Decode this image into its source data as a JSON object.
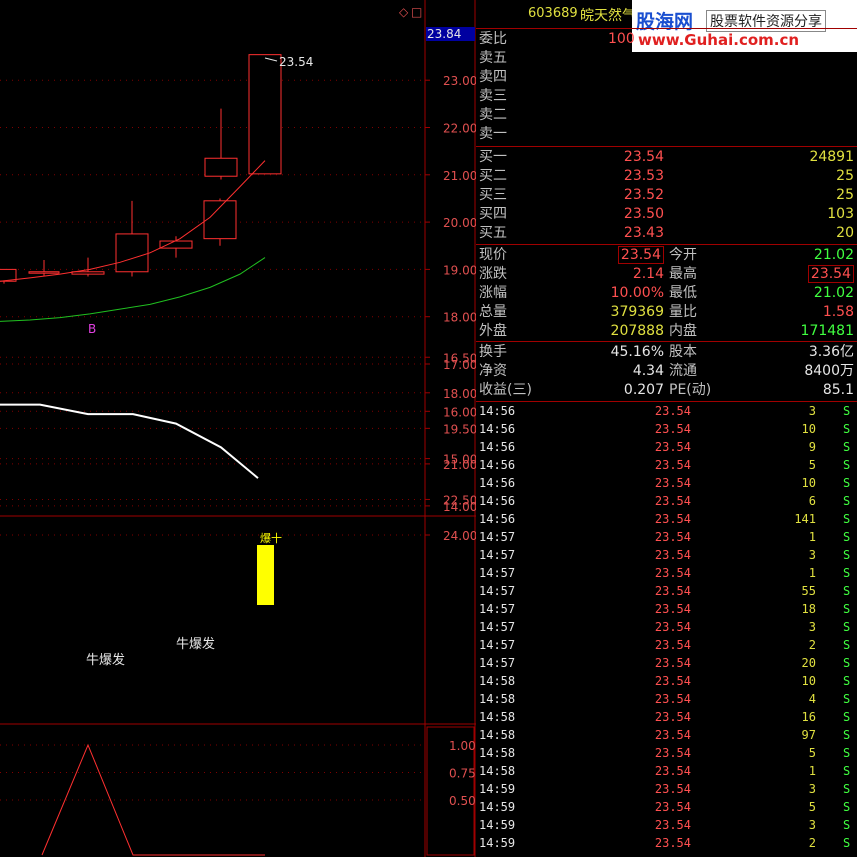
{
  "header": {
    "code": "603689",
    "name": "皖天然气"
  },
  "watermark": {
    "site_cn": "股海网",
    "slogan": "股票软件资源分享",
    "url": "www.Guhai.com.cn"
  },
  "window_icons": {
    "restore": "◇",
    "maximize": "□"
  },
  "price_chart": {
    "current_price_tag": "23.84",
    "high_label": "23.54",
    "marker_label": "B",
    "y_ticks": [
      "23.00",
      "22.00",
      "21.00",
      "20.00",
      "19.00",
      "18.00",
      "17.00",
      "16.00",
      "15.00",
      "14.00"
    ],
    "candles": [
      {
        "open": 19.0,
        "close": 18.75,
        "high": 19.0,
        "low": 18.7
      },
      {
        "open": 18.95,
        "close": 18.92,
        "high": 19.2,
        "low": 18.85
      },
      {
        "open": 18.9,
        "close": 18.95,
        "high": 19.25,
        "low": 18.85
      },
      {
        "open": 18.95,
        "close": 19.75,
        "high": 20.45,
        "low": 18.85
      },
      {
        "open": 19.45,
        "close": 19.6,
        "high": 19.7,
        "low": 19.25
      },
      {
        "open": 19.65,
        "close": 20.45,
        "high": 20.5,
        "low": 19.5
      },
      {
        "open": 20.97,
        "close": 21.35,
        "high": 22.4,
        "low": 20.9
      },
      {
        "open": 21.02,
        "close": 23.54,
        "high": 23.54,
        "low": 21.02
      }
    ],
    "ma_red": [
      18.75,
      18.82,
      18.9,
      19.0,
      19.15,
      19.35,
      19.65,
      20.1,
      20.75,
      21.3
    ],
    "ma_green": [
      17.9,
      17.93,
      17.98,
      18.06,
      18.16,
      18.26,
      18.42,
      18.62,
      18.9,
      19.25
    ]
  },
  "indicator_chart": {
    "labels": [
      "牛爆发",
      "牛爆发"
    ],
    "bar_label": "爆十",
    "y_ticks": [
      "24.00",
      "22.50",
      "21.00",
      "19.50",
      "18.00",
      "16.50"
    ],
    "line": [
      18.5,
      18.5,
      18.6,
      18.9,
      19.3,
      19.3,
      19.8,
      20.5,
      21.5,
      22.3
    ]
  },
  "lower_chart": {
    "y_ticks": [
      "1.00",
      "0.75",
      "0.50"
    ],
    "line": [
      0,
      0,
      0,
      1,
      0,
      0,
      0,
      0,
      0,
      0,
      0,
      0
    ]
  },
  "quote": {
    "weibi": {
      "label": "委比",
      "value": "100"
    },
    "sell": [
      {
        "label": "卖五"
      },
      {
        "label": "卖四"
      },
      {
        "label": "卖三"
      },
      {
        "label": "卖二"
      },
      {
        "label": "卖一"
      }
    ],
    "buy": [
      {
        "label": "买一",
        "price": "23.54",
        "vol": "24891"
      },
      {
        "label": "买二",
        "price": "23.53",
        "vol": "25"
      },
      {
        "label": "买三",
        "price": "23.52",
        "vol": "25"
      },
      {
        "label": "买四",
        "price": "23.50",
        "vol": "103"
      },
      {
        "label": "买五",
        "price": "23.43",
        "vol": "20"
      }
    ],
    "stats": [
      {
        "l1": "现价",
        "v1": "23.54",
        "l2": "今开",
        "v2": "21.02",
        "c2": "grn"
      },
      {
        "l1": "涨跌",
        "v1": "2.14",
        "l2": "最高",
        "v2": "23.54",
        "c2": "red"
      },
      {
        "l1": "涨幅",
        "v1": "10.00%",
        "l2": "最低",
        "v2": "21.02",
        "c2": "grn"
      },
      {
        "l1": "总量",
        "v1": "379369",
        "l2": "量比",
        "v2": "1.58",
        "c2": "red"
      },
      {
        "l1": "外盘",
        "v1": "207888",
        "l2": "内盘",
        "v2": "171481",
        "c2": "grn"
      }
    ],
    "fund": [
      {
        "l1": "换手",
        "v1": "45.16%",
        "l2": "股本",
        "v2": "3.36亿"
      },
      {
        "l1": "净资",
        "v1": "4.34",
        "l2": "流通",
        "v2": "8400万"
      },
      {
        "l1": "收益(三)",
        "v1": "0.207",
        "l2": "PE(动)",
        "v2": "85.1"
      }
    ]
  },
  "ticks": [
    {
      "t": "14:56",
      "p": "23.54",
      "v": "3",
      "s": "S"
    },
    {
      "t": "14:56",
      "p": "23.54",
      "v": "10",
      "s": "S"
    },
    {
      "t": "14:56",
      "p": "23.54",
      "v": "9",
      "s": "S"
    },
    {
      "t": "14:56",
      "p": "23.54",
      "v": "5",
      "s": "S"
    },
    {
      "t": "14:56",
      "p": "23.54",
      "v": "10",
      "s": "S"
    },
    {
      "t": "14:56",
      "p": "23.54",
      "v": "6",
      "s": "S"
    },
    {
      "t": "14:56",
      "p": "23.54",
      "v": "141",
      "s": "S"
    },
    {
      "t": "14:57",
      "p": "23.54",
      "v": "1",
      "s": "S"
    },
    {
      "t": "14:57",
      "p": "23.54",
      "v": "3",
      "s": "S"
    },
    {
      "t": "14:57",
      "p": "23.54",
      "v": "1",
      "s": "S"
    },
    {
      "t": "14:57",
      "p": "23.54",
      "v": "55",
      "s": "S"
    },
    {
      "t": "14:57",
      "p": "23.54",
      "v": "18",
      "s": "S"
    },
    {
      "t": "14:57",
      "p": "23.54",
      "v": "3",
      "s": "S"
    },
    {
      "t": "14:57",
      "p": "23.54",
      "v": "2",
      "s": "S"
    },
    {
      "t": "14:57",
      "p": "23.54",
      "v": "20",
      "s": "S"
    },
    {
      "t": "14:58",
      "p": "23.54",
      "v": "10",
      "s": "S"
    },
    {
      "t": "14:58",
      "p": "23.54",
      "v": "4",
      "s": "S"
    },
    {
      "t": "14:58",
      "p": "23.54",
      "v": "16",
      "s": "S"
    },
    {
      "t": "14:58",
      "p": "23.54",
      "v": "97",
      "s": "S"
    },
    {
      "t": "14:58",
      "p": "23.54",
      "v": "5",
      "s": "S"
    },
    {
      "t": "14:58",
      "p": "23.54",
      "v": "1",
      "s": "S"
    },
    {
      "t": "14:59",
      "p": "23.54",
      "v": "3",
      "s": "S"
    },
    {
      "t": "14:59",
      "p": "23.54",
      "v": "5",
      "s": "S"
    },
    {
      "t": "14:59",
      "p": "23.54",
      "v": "3",
      "s": "S"
    },
    {
      "t": "14:59",
      "p": "23.54",
      "v": "2",
      "s": "S"
    }
  ]
}
